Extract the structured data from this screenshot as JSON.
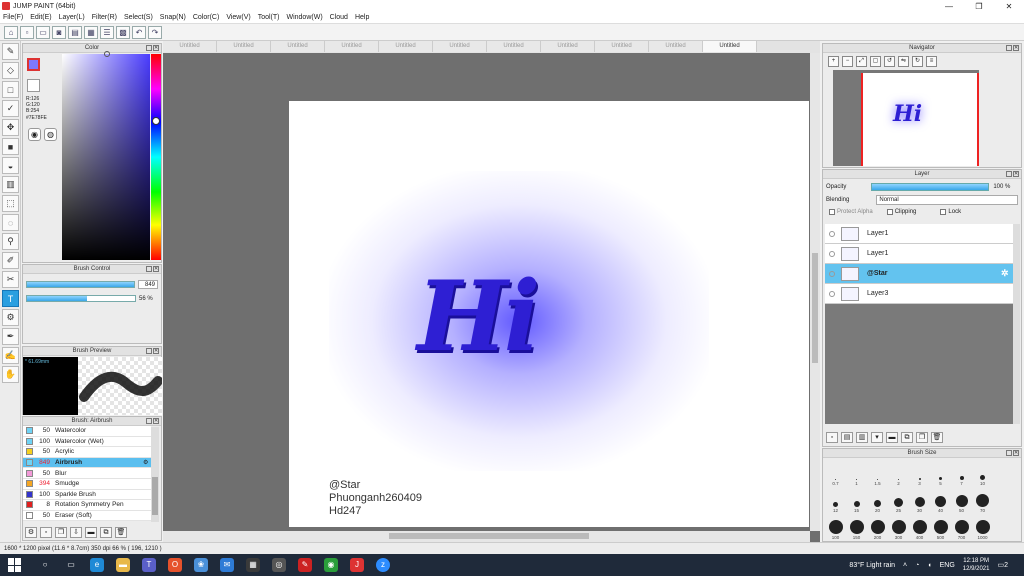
{
  "window": {
    "title": "JUMP PAINT (64bit)"
  },
  "menu": [
    "File(F)",
    "Edit(E)",
    "Layer(L)",
    "Filter(R)",
    "Select(S)",
    "Snap(N)",
    "Color(C)",
    "View(V)",
    "Tool(T)",
    "Window(W)",
    "Cloud",
    "Help"
  ],
  "color_panel": {
    "title": "Color",
    "r": "R:126",
    "g": "G:120",
    "b": "B:254",
    "hex": "#7E78FE",
    "fg_color": "#7e78fe"
  },
  "brush_control": {
    "title": "Brush Control",
    "size_value": "849",
    "size_fraction": 1.0,
    "opacity_value": "56",
    "opacity_unit": "%",
    "opacity_fraction": 0.56
  },
  "brush_preview": {
    "title": "Brush Preview",
    "size_label": "* 61.69mm"
  },
  "brush_list": {
    "title": "Brush: Airbrush",
    "items": [
      {
        "num": "50",
        "name": "Watercolor",
        "color": "#6fd3f5"
      },
      {
        "num": "100",
        "name": "Watercolor (Wet)",
        "color": "#6fd3f5"
      },
      {
        "num": "50",
        "name": "Acrylic",
        "color": "#f5d020"
      },
      {
        "num": "849",
        "name": "Airbrush",
        "color": "#6fd3f5"
      },
      {
        "num": "50",
        "name": "Blur",
        "color": "#f39ad8"
      },
      {
        "num": "394",
        "name": "Smudge",
        "color": "#f5a623"
      },
      {
        "num": "100",
        "name": "Sparkle Brush",
        "color": "#3333cc"
      },
      {
        "num": "8",
        "name": "Rotation Symmetry Pen",
        "color": "#e02020"
      },
      {
        "num": "50",
        "name": "Eraser (Soft)",
        "color": "#ffffff"
      }
    ]
  },
  "tabs": [
    "Untitled",
    "Untitled",
    "Untitled",
    "Untitled",
    "Untitled",
    "Untitled",
    "Untitled",
    "Untitled",
    "Untitled",
    "Untitled",
    "Untitled"
  ],
  "canvas": {
    "text": "Hi",
    "signature": [
      "@Star",
      "Phuonganh260409",
      "Hd247"
    ]
  },
  "navigator": {
    "title": "Navigator",
    "preview_text": "Hi"
  },
  "layer_panel": {
    "title": "Layer",
    "opacity_label": "Opacity",
    "opacity_value": "100 %",
    "blending_label": "Blending",
    "blending_value": "Normal",
    "protect_alpha": "Protect Alpha",
    "clipping": "Clipping",
    "lock": "Lock",
    "layers": [
      "Layer1",
      "Layer1",
      "@Star",
      "Layer3"
    ]
  },
  "brush_size": {
    "title": "Brush Size",
    "sizes": [
      "0.7",
      "1",
      "1.5",
      "2",
      "3",
      "5",
      "7",
      "10",
      "12",
      "15",
      "20",
      "25",
      "30",
      "40",
      "50",
      "70",
      "100",
      "150",
      "200",
      "300",
      "400",
      "500",
      "700",
      "1000"
    ]
  },
  "status_bar": "1600 * 1200 pixel  (11.6 * 8.7cm)  350 dpi  66 %  ( 196, 1210 )",
  "taskbar": {
    "weather": "83°F  Light rain",
    "lang": "ENG",
    "time": "12:18 PM",
    "date": "12/9/2021",
    "notif": "2"
  }
}
